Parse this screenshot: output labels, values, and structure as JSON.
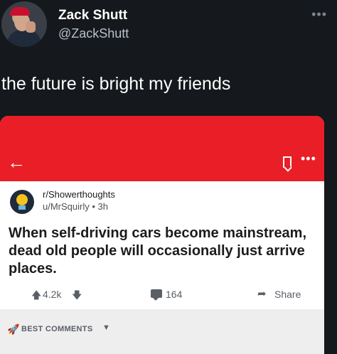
{
  "tweet": {
    "display_name": "Zack Shutt",
    "handle": "@ZackShutt",
    "text": "the future is bright my friends",
    "more_icon": "more-horizontal-icon"
  },
  "reddit_card": {
    "accent_color": "#e91e26",
    "back_icon": "arrow-left-icon",
    "bookmark_icon": "bookmark-icon",
    "more_icon": "more-horizontal-icon",
    "subreddit": "r/Showerthoughts",
    "poster": "u/MrSquirly • 3h",
    "title": "When self-driving cars become mainstream, dead old people will occasionally just arrive places.",
    "votes": "4.2k",
    "comments": "164",
    "share_label": "Share",
    "sort_label": "BEST COMMENTS"
  }
}
